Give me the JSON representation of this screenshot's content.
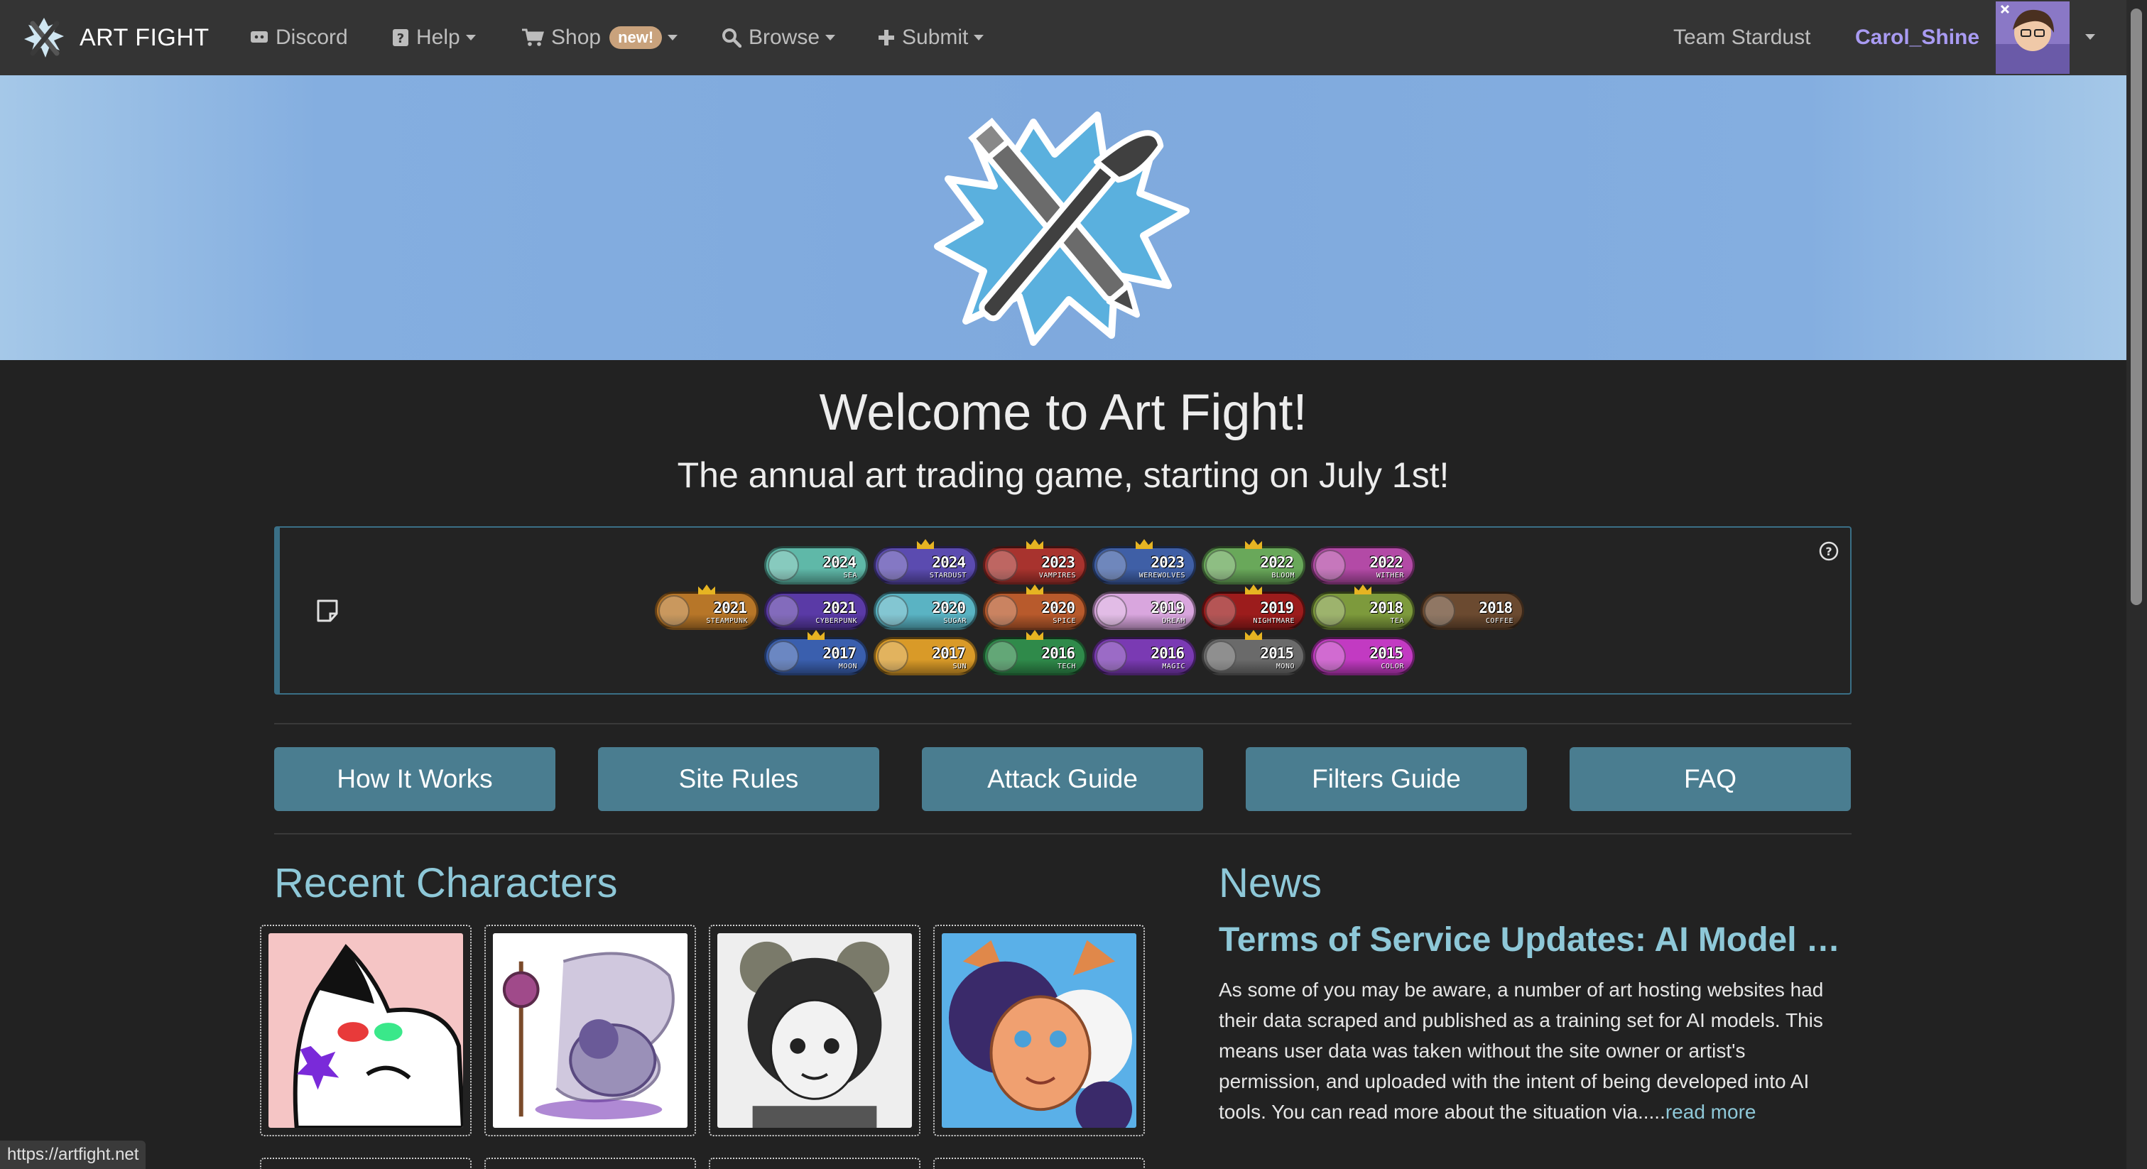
{
  "nav": {
    "brand": "ART FIGHT",
    "discord": "Discord",
    "help": "Help",
    "shop": "Shop",
    "shop_badge": "new!",
    "browse": "Browse",
    "submit": "Submit",
    "team": "Team Stardust",
    "username": "Carol_Shine"
  },
  "hero": {
    "title": "Welcome to Art Fight!",
    "subtitle": "The annual art trading game, starting on July 1st!"
  },
  "badges": {
    "row1": [
      {
        "year": "2024",
        "name": "Sea",
        "color": "#5fb8a8",
        "crown": false
      },
      {
        "year": "2024",
        "name": "Stardust",
        "color": "#5b4bb0",
        "crown": true
      },
      {
        "year": "2023",
        "name": "Vampires",
        "color": "#a8332e",
        "crown": true
      },
      {
        "year": "2023",
        "name": "Werewolves",
        "color": "#3f5fa6",
        "crown": true
      },
      {
        "year": "2022",
        "name": "Bloom",
        "color": "#69a85a",
        "crown": true
      },
      {
        "year": "2022",
        "name": "Wither",
        "color": "#b34aa6",
        "crown": false
      }
    ],
    "row2": [
      {
        "year": "2021",
        "name": "Steampunk",
        "color": "#b77628",
        "crown": true
      },
      {
        "year": "2021",
        "name": "Cyberpunk",
        "color": "#5a3aa6",
        "crown": false
      },
      {
        "year": "2020",
        "name": "Sugar",
        "color": "#5ab3c3",
        "crown": false
      },
      {
        "year": "2020",
        "name": "Spice",
        "color": "#b85a2c",
        "crown": true
      },
      {
        "year": "2019",
        "name": "Dream",
        "color": "#d9a6de",
        "crown": false
      },
      {
        "year": "2019",
        "name": "Nightmare",
        "color": "#9c1c1c",
        "crown": true
      },
      {
        "year": "2018",
        "name": "Tea",
        "color": "#7d9a3c",
        "crown": true
      },
      {
        "year": "2018",
        "name": "Coffee",
        "color": "#6b4a30",
        "crown": false
      }
    ],
    "row3": [
      {
        "year": "2017",
        "name": "Moon",
        "color": "#3a5fae",
        "crown": true
      },
      {
        "year": "2017",
        "name": "Sun",
        "color": "#d99a28",
        "crown": false
      },
      {
        "year": "2016",
        "name": "Tech",
        "color": "#2f8a4a",
        "crown": true
      },
      {
        "year": "2016",
        "name": "Magic",
        "color": "#7a3ab3",
        "crown": false
      },
      {
        "year": "2015",
        "name": "Mono",
        "color": "#6a6a6a",
        "crown": true
      },
      {
        "year": "2015",
        "name": "Color",
        "color": "#c23ac2",
        "crown": false
      }
    ]
  },
  "guides": [
    "How It Works",
    "Site Rules",
    "Attack Guide",
    "Filters Guide",
    "FAQ"
  ],
  "recent": {
    "title": "Recent Characters"
  },
  "news": {
    "heading": "News",
    "post_title": "Terms of Service Updates: AI Model Tr...",
    "body": "As some of you may be aware, a number of art hosting websites had their data scraped and published as a training set for AI models. This means user data was taken without the site owner or artist's permission, and uploaded with the intent of being developed into AI tools. You can read more about the situation via.....",
    "read_more": "read more"
  },
  "status_url": "https://artfight.net",
  "colors": {
    "navbar": "#343434",
    "background": "#222222",
    "accent": "#8ec8d8",
    "button": "#4a7d90",
    "username": "#a99bf2"
  }
}
